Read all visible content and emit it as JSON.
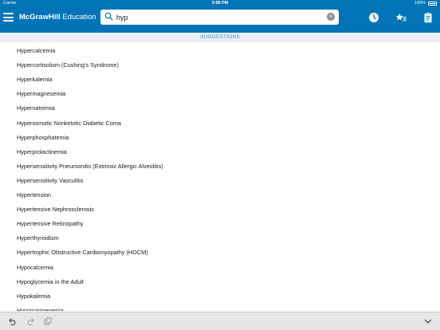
{
  "status": {
    "carrier": "Carrier",
    "time": "3:58 PM",
    "battery": "100%"
  },
  "header": {
    "brand_bold": "McGrawHill",
    "brand_rest": " Education"
  },
  "search": {
    "value": "hyp",
    "placeholder": ""
  },
  "section_label": "SUGGESTIONS",
  "suggestions": [
    "Hypercalcemia",
    "Hypercortisolism (Cushing's Syndrome)",
    "Hyperkalemia",
    "Hypermagnesemia",
    "Hypernatremia",
    "Hyperosmotic Nonketotic Diabetic Coma",
    "Hyperphosphatemia",
    "Hyperprolactinemia",
    "Hypersensitivity Pneumonitis (Extrinsic Allergic Alveolitis)",
    "Hypersensitivity Vasculitis",
    "Hypertension",
    "Hypertensive Nephrosclerosis",
    "Hypertensive Retinopathy",
    "Hyperthyroidism",
    "Hypertrophic Obstructive Cardiomyopathy (HOCM)",
    "Hypocalcemia",
    "Hypoglycemia in the Adult",
    "Hypokalemia",
    "Hypomagnesemia"
  ],
  "icons": {
    "menu": "hamburger-menu-icon",
    "search": "search-icon",
    "clear": "clear-icon",
    "history": "history-clock-icon",
    "favorites": "favorites-star-list-icon",
    "clipboard": "clipboard-document-icon",
    "undo": "undo-icon",
    "redo": "redo-icon",
    "copy": "copy-icon",
    "collapse": "chevron-down-icon"
  },
  "colors": {
    "header_bg": "#0074b7",
    "suggestion_bar_bg": "#e9eff4",
    "suggestion_text": "#3d8fc9",
    "bottom_bar_bg": "#e6e6e6"
  }
}
